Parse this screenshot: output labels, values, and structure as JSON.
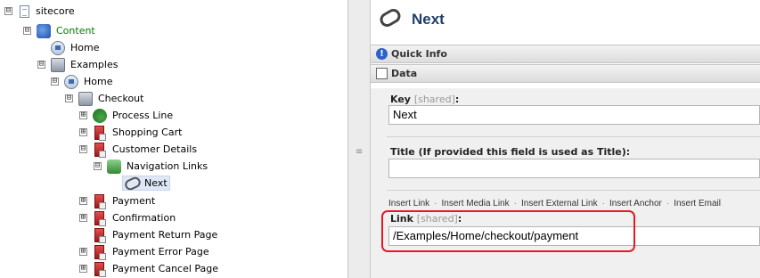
{
  "tree": {
    "root": "sitecore",
    "content": "Content",
    "home": "Home",
    "examples": "Examples",
    "examples_home": "Home",
    "checkout": "Checkout",
    "process_line": "Process Line",
    "shopping_cart": "Shopping Cart",
    "customer_details": "Customer Details",
    "navigation_links": "Navigation Links",
    "next": "Next",
    "payment": "Payment",
    "confirmation": "Confirmation",
    "payment_return": "Payment Return Page",
    "payment_error": "Payment Error Page",
    "payment_cancel": "Payment Cancel Page",
    "expander_collapse": "⊟",
    "expander_expand": "⊞"
  },
  "editor": {
    "item_title": "Next",
    "quick_info": "Quick Info",
    "data_section": "Data",
    "key_label": "Key",
    "shared_tag": "[shared]",
    "colon": ":",
    "key_value": "Next",
    "title_label": "Title (If provided this field is used as Title):",
    "title_value": "",
    "link_actions": [
      "Insert Link",
      "Insert Media Link",
      "Insert External Link",
      "Insert Anchor",
      "Insert Email"
    ],
    "link_label": "Link",
    "link_value": "/Examples/Home/checkout/payment"
  },
  "icons": {
    "expand_collapse": "tree-expander-icon",
    "document": "document-icon",
    "content": "content-icon",
    "home": "home-icon",
    "folder": "folder-stack-icon",
    "link": "link-icon",
    "info": "info-icon"
  },
  "colors": {
    "highlight": "#e41b23",
    "selected_bg": "#dfe8f6",
    "content_text": "#008000",
    "title_text": "#1f3f6a"
  }
}
